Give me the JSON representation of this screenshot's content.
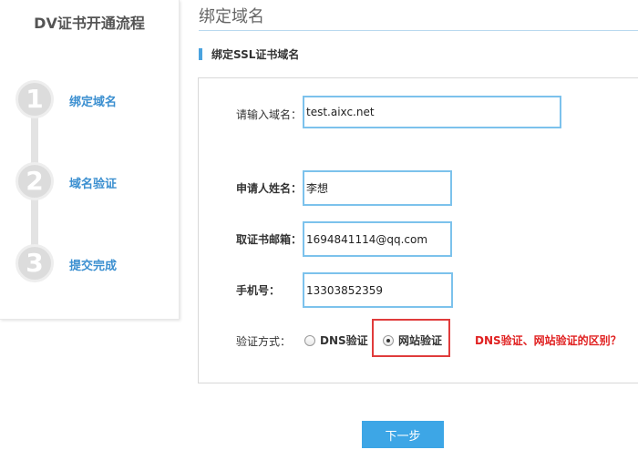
{
  "sidebar": {
    "title": "DV证书开通流程",
    "steps": [
      {
        "number": "1",
        "label": "绑定域名"
      },
      {
        "number": "2",
        "label": "域名验证"
      },
      {
        "number": "3",
        "label": "提交完成"
      }
    ]
  },
  "main": {
    "heading": "绑定域名",
    "section_title": "绑定SSL证书域名",
    "form": {
      "domain_label": "请输入域名：",
      "domain_value": "test.aixc.net",
      "name_label": "申请人姓名：",
      "name_value": "李想",
      "email_label": "取证书邮箱：",
      "email_value": "1694841114@qq.com",
      "phone_label": "手机号：",
      "phone_value": "13303852359",
      "verify_label": "验证方式：",
      "options": [
        {
          "label": "DNS验证",
          "checked": false
        },
        {
          "label": "网站验证",
          "checked": true
        }
      ],
      "help_link": "DNS验证、网站验证的区别？"
    },
    "next_button": "下一步"
  },
  "colors": {
    "accent": "#3da6e6",
    "link_blue": "#3b8fd0",
    "input_border": "#7cc2ec",
    "warning_red": "#e02020"
  }
}
